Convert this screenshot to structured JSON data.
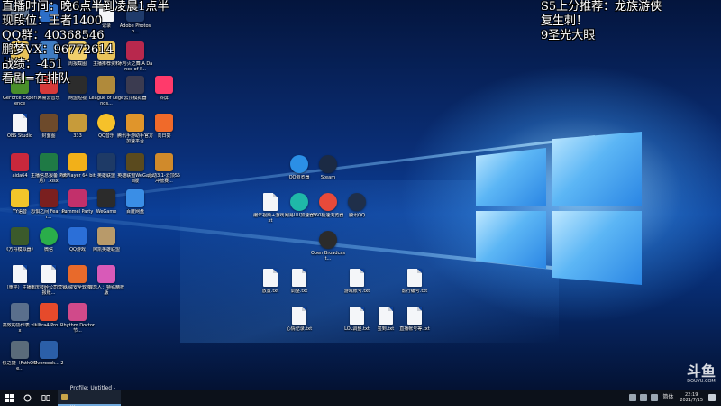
{
  "overlay_left": [
    "直播时间：晚6点半到凌晨1点半",
    "现段位：王者1400",
    "QQ群：40368546",
    "鹏梦VX：96772614",
    "战绩：-451",
    "看剧=在排队"
  ],
  "overlay_right": [
    "S5上分推荐：龙族游侠",
    "复生刺！",
    "9圣光大眼"
  ],
  "watermark": {
    "logo": "斗鱼",
    "url": "DOUYU.COM"
  },
  "desktop_icons": [
    {
      "label": "",
      "icon": "app-icon",
      "color": "#5a6f8c"
    },
    {
      "label": "",
      "icon": "app-icon",
      "color": "#2d6fc8"
    },
    {
      "label": "记录",
      "icon": "file-icon",
      "color": ""
    },
    {
      "label": "Adobe Photosh...",
      "icon": "photoshop-icon",
      "color": "#1f3b6b"
    },
    {
      "label": "",
      "icon": "folder-icon",
      "color": "#e8c35a"
    },
    {
      "label": "",
      "icon": "app-icon",
      "color": "#3f7cc2"
    },
    {
      "label": "周报截图",
      "icon": "folder-icon",
      "color": "#f0cf6b"
    },
    {
      "label": "主播推荐资料",
      "icon": "folder-icon",
      "color": "#e8c35a"
    },
    {
      "label": "冰与火之舞 A Dance of F...",
      "icon": "game-icon",
      "color": "#b8284d"
    },
    {
      "label": "GeForce Experience",
      "icon": "geforce-icon",
      "color": "#4a8f2a"
    },
    {
      "label": "网易云音乐",
      "icon": "netease-music-icon",
      "color": "#d83a3a"
    },
    {
      "label": "网盟短视",
      "icon": "video-icon",
      "color": "#2c2c2c"
    },
    {
      "label": "League of Legends...",
      "icon": "league-icon",
      "color": "#b08a3b"
    },
    {
      "label": "云顶模拟器",
      "icon": "game-icon",
      "color": "#3b3b50"
    },
    {
      "label": "抖屏",
      "icon": "douping-icon",
      "color": "#ff3a6b"
    },
    {
      "label": "OBS Studio",
      "icon": "file-icon",
      "color": ""
    },
    {
      "label": "封面图",
      "icon": "image-icon",
      "color": "#6d4a2b"
    },
    {
      "label": "333",
      "icon": "folder-icon",
      "color": "#c79b3a"
    },
    {
      "label": "QQ音乐",
      "icon": "qq-music-icon",
      "color": "#f6c12a"
    },
    {
      "label": "腾讯手游助手官方加速平台",
      "icon": "game-icon",
      "color": "#e0952b"
    },
    {
      "label": "向日葵",
      "icon": "sunflower-icon",
      "color": "#f06a2a"
    },
    {
      "label": "aida64",
      "icon": "aida-icon",
      "color": "#c8283c"
    },
    {
      "label": "主播信息报备（腾月）.xlsx",
      "icon": "excel-icon",
      "color": "#1f7a45"
    },
    {
      "label": "PotPlayer 64 bit",
      "icon": "potplayer-icon",
      "color": "#f2b019"
    },
    {
      "label": "英雄联盟",
      "icon": "league-icon",
      "color": "#1e3a66"
    },
    {
      "label": "英雄联盟WeGame版",
      "icon": "league-icon",
      "color": "#5a4a1e"
    },
    {
      "label": "活动3.1-云顶S5冲榜赛...",
      "icon": "image-icon",
      "color": "#d08a2b"
    },
    {
      "label": "YY语音",
      "icon": "yy-icon",
      "color": "#f2c52a"
    },
    {
      "label": "恐惧之间 Fear sur...",
      "icon": "game-icon",
      "color": "#7a1f1f"
    },
    {
      "label": "Pummel Party",
      "icon": "game-icon",
      "color": "#c2306b"
    },
    {
      "label": "WeGame",
      "icon": "wegame-icon",
      "color": "#2b2b2b"
    },
    {
      "label": "百度网盘",
      "icon": "baidu-netdisk-icon",
      "color": "#3a8ee6"
    },
    {
      "label": "《方舟模拟器》",
      "icon": "game-icon",
      "color": "#3b5a2b"
    },
    {
      "label": "微信",
      "icon": "wechat-icon",
      "color": "#2aae4a"
    },
    {
      "label": "QQ游戏",
      "icon": "qq-game-icon",
      "color": "#2b6fd8"
    },
    {
      "label": "阿凯英雄联盟",
      "icon": "game-icon",
      "color": "#b89a6a"
    },
    {
      "label": "（重平）主播...",
      "icon": "file-icon",
      "color": ""
    },
    {
      "label": "重庆枝经公司营销报账...",
      "icon": "file-icon",
      "color": ""
    },
    {
      "label": "火绒安全软件",
      "icon": "huorong-icon",
      "color": "#e86a2b"
    },
    {
      "label": "蝶恋人：特殊精校版",
      "icon": "game-icon",
      "color": "#d85ab8"
    },
    {
      "label": "高效的协作表.xlsx",
      "icon": "excel-icon",
      "color": ""
    },
    {
      "label": "Ultra4-Pro...",
      "icon": "game-icon",
      "color": "#e64a2b"
    },
    {
      "label": "Rhythm Doctor 节...",
      "icon": "game-icon",
      "color": "#d04a8a"
    },
    {
      "label": "快之捷（FathOMe...",
      "icon": "app-icon",
      "color": "#5a6b7a"
    },
    {
      "label": "Overcook... 2",
      "icon": "game-icon",
      "color": "#2b5fa8"
    }
  ],
  "center_icons": [
    {
      "label": "QQ浏览器",
      "icon": "qq-browser-icon",
      "color": "#2b8fe6"
    },
    {
      "label": "Steam",
      "icon": "steam-icon",
      "color": "#1b2a44"
    },
    {
      "label": "编年视频+游戏.txt",
      "icon": "file-icon",
      "color": ""
    },
    {
      "label": "网易UU加速器",
      "icon": "uu-accelerator-icon",
      "color": "#1fb8a8"
    },
    {
      "label": "360极速浏览器",
      "icon": "browser-360-icon",
      "color": "#e84a3a"
    },
    {
      "label": "腾讯QQ",
      "icon": "qq-icon",
      "color": "#1f2f4a"
    },
    {
      "label": "Open Broadcast...",
      "icon": "obs-icon",
      "color": "#2b2b2b"
    },
    {
      "label": "放置.txt",
      "icon": "file-icon",
      "color": ""
    },
    {
      "label": "调整.txt",
      "icon": "file-icon",
      "color": ""
    },
    {
      "label": "游戏账号.txt",
      "icon": "file-icon",
      "color": ""
    },
    {
      "label": "影行编号.txt",
      "icon": "file-icon",
      "color": ""
    },
    {
      "label": "心情记录.txt",
      "icon": "file-icon",
      "color": ""
    },
    {
      "label": "LOL调整.txt",
      "icon": "file-icon",
      "color": ""
    },
    {
      "label": "签到.txt",
      "icon": "file-icon",
      "color": ""
    },
    {
      "label": "直播帐号等.txt",
      "icon": "file-icon",
      "color": ""
    }
  ],
  "taskbar": {
    "app_label": "Profile: Untitled - ...",
    "lang": "简体",
    "time": "22:19",
    "date": "2021/7/15"
  }
}
